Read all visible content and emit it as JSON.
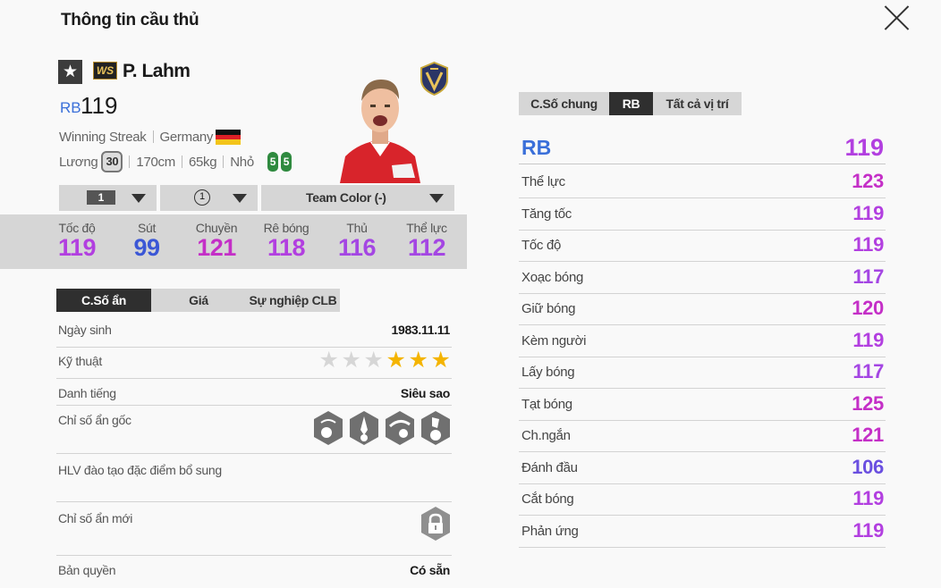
{
  "window": {
    "title": "Thông tin cầu thủ"
  },
  "player": {
    "name": "P. Lahm",
    "season_badge": "WS",
    "position": "RB",
    "overall": "119",
    "team": "Winning Streak",
    "nation": "Germany",
    "salary_label": "Lương",
    "salary": "30",
    "height": "170cm",
    "weight": "65kg",
    "body_type": "Nhỏ",
    "weak_foot_left": "5",
    "weak_foot_right": "5"
  },
  "dropdowns": {
    "upgrade_level": "1",
    "team_skill": "1",
    "team_color": "Team Color (-)"
  },
  "main_stats": [
    {
      "label": "Tốc độ",
      "value": "119",
      "color": "#b23fe0"
    },
    {
      "label": "Sút",
      "value": "99",
      "color": "#3b57d6"
    },
    {
      "label": "Chuyền",
      "value": "121",
      "color": "#c42fc7"
    },
    {
      "label": "Rê bóng",
      "value": "118",
      "color": "#b23fe0"
    },
    {
      "label": "Thủ",
      "value": "116",
      "color": "#a446e3"
    },
    {
      "label": "Thể lực",
      "value": "112",
      "color": "#a446e3"
    }
  ],
  "tabs": [
    "C.Số ẩn",
    "Giá",
    "Sự nghiệp CLB"
  ],
  "hidden": {
    "birth_label": "Ngày sinh",
    "birth": "1983.11.11",
    "skill_label": "Kỹ thuật",
    "skill_stars": 3,
    "skill_stars_max": 6,
    "fame_label": "Danh tiếng",
    "fame": "Siêu sao",
    "traits_label": "Chỉ số ẩn gốc",
    "traits_icons": [
      "trait-icon-1",
      "trait-icon-2",
      "trait-icon-3",
      "trait-icon-4"
    ],
    "coach_label": "HLV đào tạo đặc điểm bổ sung",
    "new_traits_label": "Chỉ số ẩn mới",
    "license_label": "Bản quyền",
    "license": "Có sẵn"
  },
  "right": {
    "tabs": [
      "C.Số chung",
      "RB",
      "Tất cả vị trí"
    ],
    "active_tab": "RB",
    "position": "RB",
    "overall": "119",
    "overall_color": "#b23fe0",
    "attributes": [
      {
        "name": "Thể lực",
        "value": "123",
        "color": "#c42fc7"
      },
      {
        "name": "Tăng tốc",
        "value": "119",
        "color": "#b23fe0"
      },
      {
        "name": "Tốc độ",
        "value": "119",
        "color": "#b23fe0"
      },
      {
        "name": "Xoạc bóng",
        "value": "117",
        "color": "#a446e3"
      },
      {
        "name": "Giữ bóng",
        "value": "120",
        "color": "#c42fc7"
      },
      {
        "name": "Kèm người",
        "value": "119",
        "color": "#b23fe0"
      },
      {
        "name": "Lấy bóng",
        "value": "117",
        "color": "#a446e3"
      },
      {
        "name": "Tạt bóng",
        "value": "125",
        "color": "#c42fc7"
      },
      {
        "name": "Ch.ngắn",
        "value": "121",
        "color": "#c42fc7"
      },
      {
        "name": "Đánh đầu",
        "value": "106",
        "color": "#6a4fe0"
      },
      {
        "name": "Cắt bóng",
        "value": "119",
        "color": "#b23fe0"
      },
      {
        "name": "Phản ứng",
        "value": "119",
        "color": "#b23fe0"
      }
    ]
  }
}
